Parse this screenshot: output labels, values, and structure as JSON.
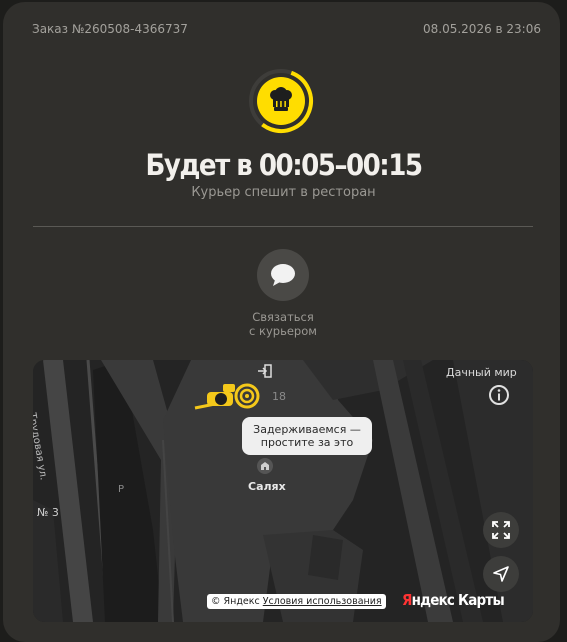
{
  "order": {
    "number": "Заказ №260508-4366737",
    "datetime": "08.05.2026 в 23:06"
  },
  "status": {
    "eta": "Будет в 00:05–00:15",
    "subtitle": "Курьер спешит в ресторан",
    "icon": "chef-hat-icon",
    "progress_fraction": 0.55,
    "accent_color": "#ffdd00"
  },
  "contact": {
    "line1": "Связаться",
    "line2": "с курьером",
    "icon": "chat-bubble-icon"
  },
  "map": {
    "tooltip_line1": "Задерживаемся —",
    "tooltip_line2": "простите за это",
    "place_name": "Салях",
    "district": "Дачный мир",
    "street": "Трудовая ул.",
    "house_number": "18",
    "parking": "P",
    "edge_label_left": "№ 3",
    "copyright_prefix": "© Яндекс",
    "terms_link": "Условия использования",
    "logo_part1": "Я",
    "logo_part2": "ндекс Карты"
  }
}
